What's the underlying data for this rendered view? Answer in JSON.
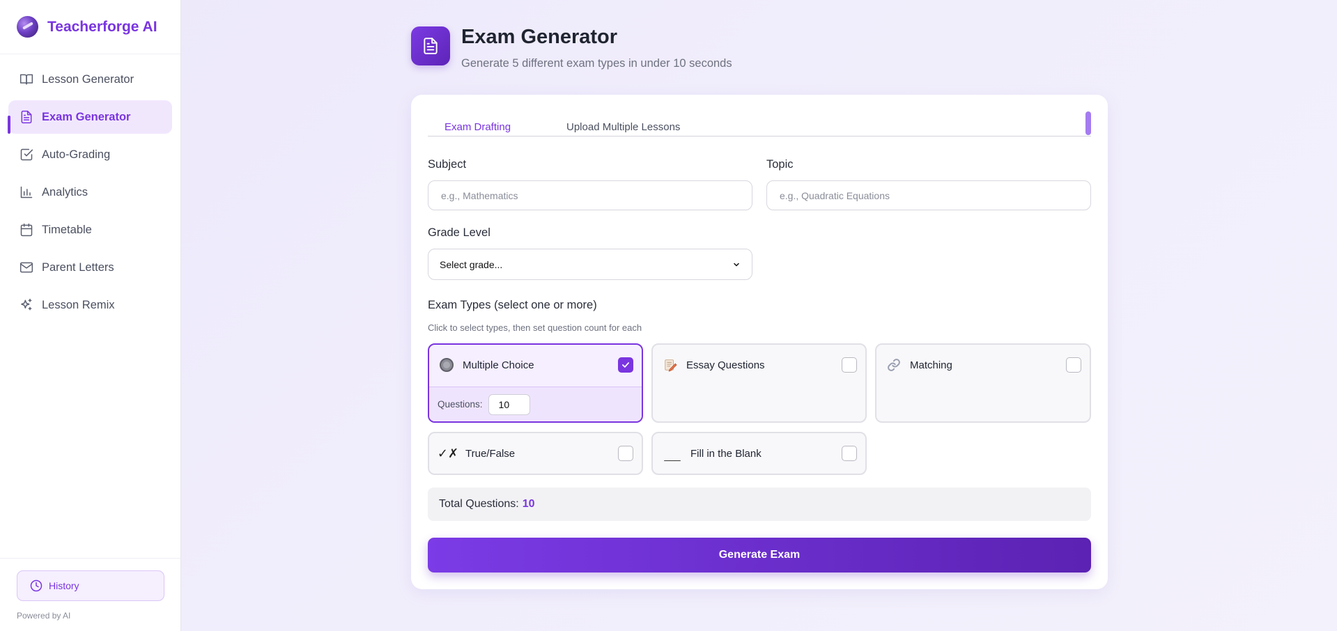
{
  "brand": {
    "name": "Teacherforge AI"
  },
  "sidebar": {
    "items": [
      {
        "label": "Lesson Generator",
        "icon": "book-icon"
      },
      {
        "label": "Exam Generator",
        "icon": "document-icon",
        "active": true
      },
      {
        "label": "Auto-Grading",
        "icon": "check-square-icon"
      },
      {
        "label": "Analytics",
        "icon": "bar-chart-icon"
      },
      {
        "label": "Timetable",
        "icon": "calendar-icon"
      },
      {
        "label": "Parent Letters",
        "icon": "mail-icon"
      },
      {
        "label": "Lesson Remix",
        "icon": "sparkles-icon"
      }
    ],
    "history_label": "History",
    "powered_by": "Powered by AI"
  },
  "header": {
    "title": "Exam Generator",
    "subtitle": "Generate 5 different exam types in under 10 seconds"
  },
  "tabs": [
    "Exam Drafting",
    "Upload Multiple Lessons"
  ],
  "form": {
    "subject_label": "Subject",
    "subject_placeholder": "e.g., Mathematics",
    "topic_label": "Topic",
    "topic_placeholder": "e.g., Quadratic Equations",
    "grade_label": "Grade Level",
    "grade_value": "Select grade..."
  },
  "exam_types": {
    "title": "Exam Types (select one or more)",
    "subtitle": "Click to select types, then set question count for each",
    "questions_label": "Questions:",
    "items": [
      {
        "name": "Multiple Choice",
        "icon": "radio-circle-icon",
        "selected": true,
        "questions": "10"
      },
      {
        "name": "Essay Questions",
        "icon": "pencil-paper-icon",
        "selected": false
      },
      {
        "name": "Matching",
        "icon": "link-icon",
        "selected": false
      },
      {
        "name": "True/False",
        "icon": "checkmark-x-icon",
        "glyph": "✓✗",
        "selected": false
      },
      {
        "name": "Fill in the Blank",
        "icon": "blank-line-icon",
        "glyph": "___",
        "selected": false
      }
    ]
  },
  "total": {
    "label": "Total Questions:",
    "value": "10"
  },
  "generate_label": "Generate Exam",
  "colors": {
    "accent": "#7a35e0",
    "accent_light": "#f1e7fd"
  }
}
